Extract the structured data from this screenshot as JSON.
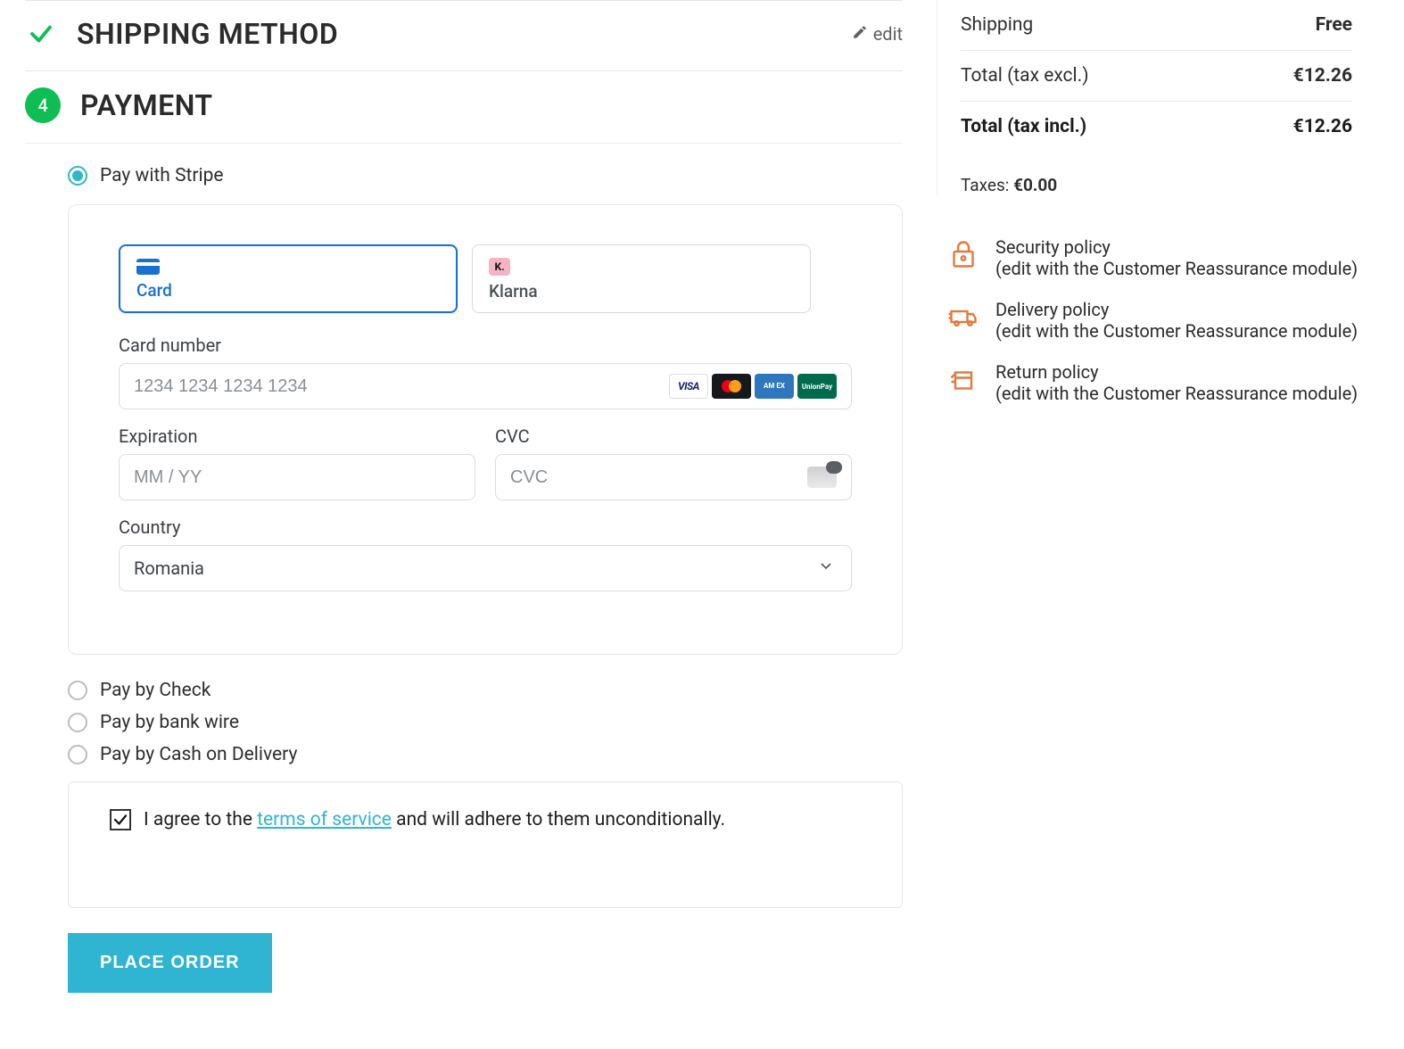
{
  "shipping_section": {
    "title": "SHIPPING METHOD",
    "edit_label": "edit"
  },
  "payment_section": {
    "step_number": "4",
    "title": "PAYMENT"
  },
  "payment_options": {
    "stripe": "Pay with Stripe",
    "check": "Pay by Check",
    "bankwire": "Pay by bank wire",
    "cod": "Pay by Cash on Delivery"
  },
  "stripe": {
    "tab_card": "Card",
    "tab_klarna": "Klarna",
    "klarna_glyph": "K.",
    "card_number_label": "Card number",
    "card_number_placeholder": "1234 1234 1234 1234",
    "expiration_label": "Expiration",
    "expiration_placeholder": "MM / YY",
    "cvc_label": "CVC",
    "cvc_placeholder": "CVC",
    "country_label": "Country",
    "country_value": "Romania",
    "brand_visa": "VISA",
    "brand_amex": "AM EX",
    "brand_unionpay": "UnionPay"
  },
  "terms": {
    "prefix": "I agree to the ",
    "link": "terms of service",
    "suffix": " and will adhere to them unconditionally."
  },
  "place_order_label": "PLACE ORDER",
  "summary": {
    "shipping_label": "Shipping",
    "shipping_value": "Free",
    "total_excl_label": "Total (tax excl.)",
    "total_excl_value": "€12.26",
    "total_incl_label": "Total (tax incl.)",
    "total_incl_value": "€12.26",
    "taxes_label": "Taxes: ",
    "taxes_value": "€0.00"
  },
  "policies": {
    "security_title": "Security policy",
    "delivery_title": "Delivery policy",
    "return_title": "Return policy",
    "subtitle": "(edit with the Customer Reassurance module)"
  }
}
